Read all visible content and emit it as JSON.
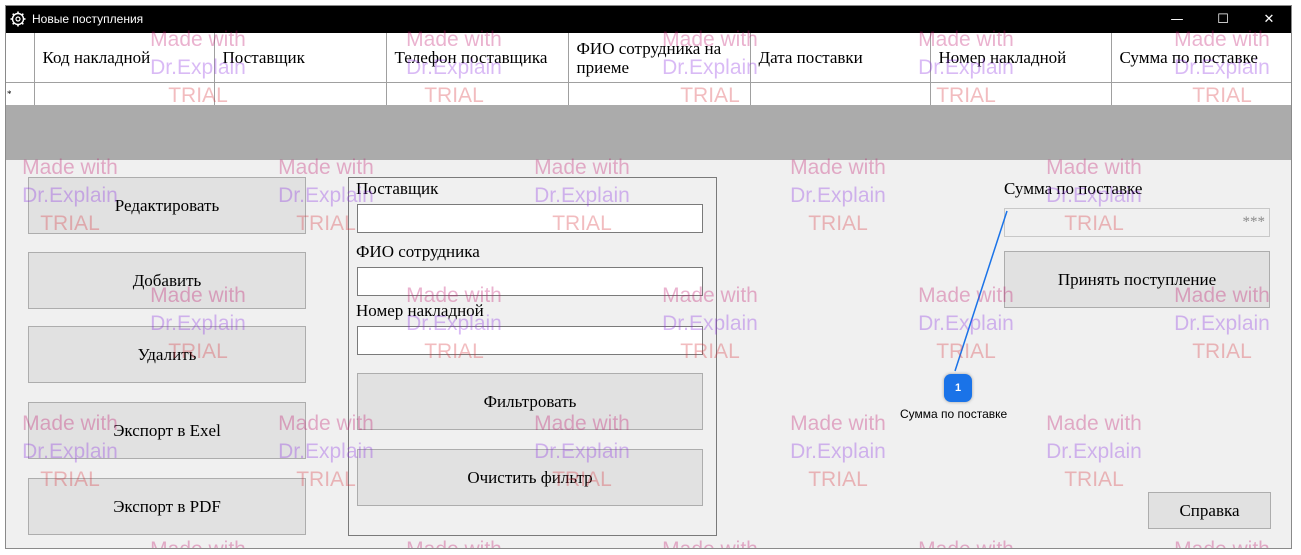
{
  "window": {
    "title": "Новые поступления",
    "controls": {
      "minimize": "—",
      "maximize": "☐",
      "close": "✕"
    }
  },
  "grid": {
    "columns": [
      "Код накладной",
      "Поставщик",
      "Телефон поставщика",
      "ФИО сотрудника на приеме",
      "Дата поставки",
      "Номер накладной",
      "Сумма по поставке"
    ],
    "new_row_marker": "*"
  },
  "left_buttons": {
    "edit": "Редактировать",
    "add": "Добавить",
    "delete": "Удалить",
    "export_excel": "Экспорт в Exel",
    "export_pdf": "Экспорт в PDF"
  },
  "filter": {
    "supplier_label": "Поставщик",
    "supplier_value": "",
    "employee_label": "ФИО сотрудника",
    "employee_value": "",
    "invoice_label": "Номер накладной",
    "invoice_value": "",
    "filter_button": "Фильтровать",
    "clear_button": "Очистить фильтр"
  },
  "right_panel": {
    "sum_label": "Сумма по поставке",
    "sum_value": "***",
    "accept_button": "Принять поступление",
    "help_button": "Справка"
  },
  "callout": {
    "number": "1",
    "label": "Сумма по поставке",
    "color": "#1a73e8"
  },
  "watermark": {
    "line1": "Made with",
    "line2": "Dr.Explain",
    "line3": "TRIAL"
  }
}
